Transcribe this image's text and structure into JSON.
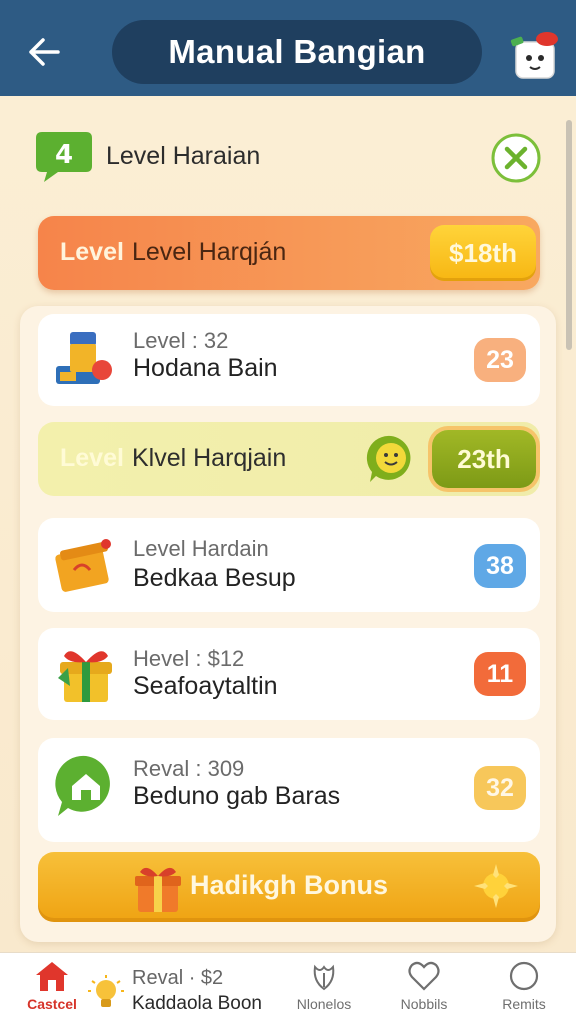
{
  "header": {
    "title": "Manual Bangian"
  },
  "section": {
    "title": "Level Haraian"
  },
  "banner": {
    "prefix": "Level",
    "label": "Level Harqján",
    "price": "$18th"
  },
  "items": [
    {
      "sub": "Level : 32",
      "main": "Hodana Bain",
      "badge": "23",
      "icon": "building-blocks-icon"
    },
    {
      "sub": "Level Hardain",
      "main": "Bedkaa Besup",
      "badge": "38",
      "icon": "treasure-box-icon"
    },
    {
      "sub": "Hevel : $12",
      "main": "Seafoaytaltin",
      "badge": "11",
      "icon": "gift-box-icon"
    },
    {
      "sub": "Reval : 309",
      "main": "Beduno gab Baras",
      "badge": "32",
      "icon": "home-chat-icon"
    }
  ],
  "highlight": {
    "prefix": "Level",
    "label": "Klvel Harqjain",
    "price": "23th"
  },
  "bonus": {
    "label": "Hadikgh Bonus"
  },
  "nav": {
    "home": "Castcel",
    "promo_sub": "Reval · $2",
    "promo_main": "Kaddaola Boon",
    "menu": "Nlonelos",
    "fav": "Nobbils",
    "more": "Remits"
  },
  "colors": {
    "header_bg": "#2e5b84",
    "title_pill": "#1f3f5f",
    "orange_banner": "#f6844a",
    "gold_button": "#f7b612",
    "highlight_row": "#f3f0ac",
    "green_price": "#7d9a16",
    "badge_peach": "#f8b07e",
    "badge_blue": "#5fa8e6",
    "badge_red": "#f26b3a",
    "badge_yellow": "#f7c75a"
  }
}
